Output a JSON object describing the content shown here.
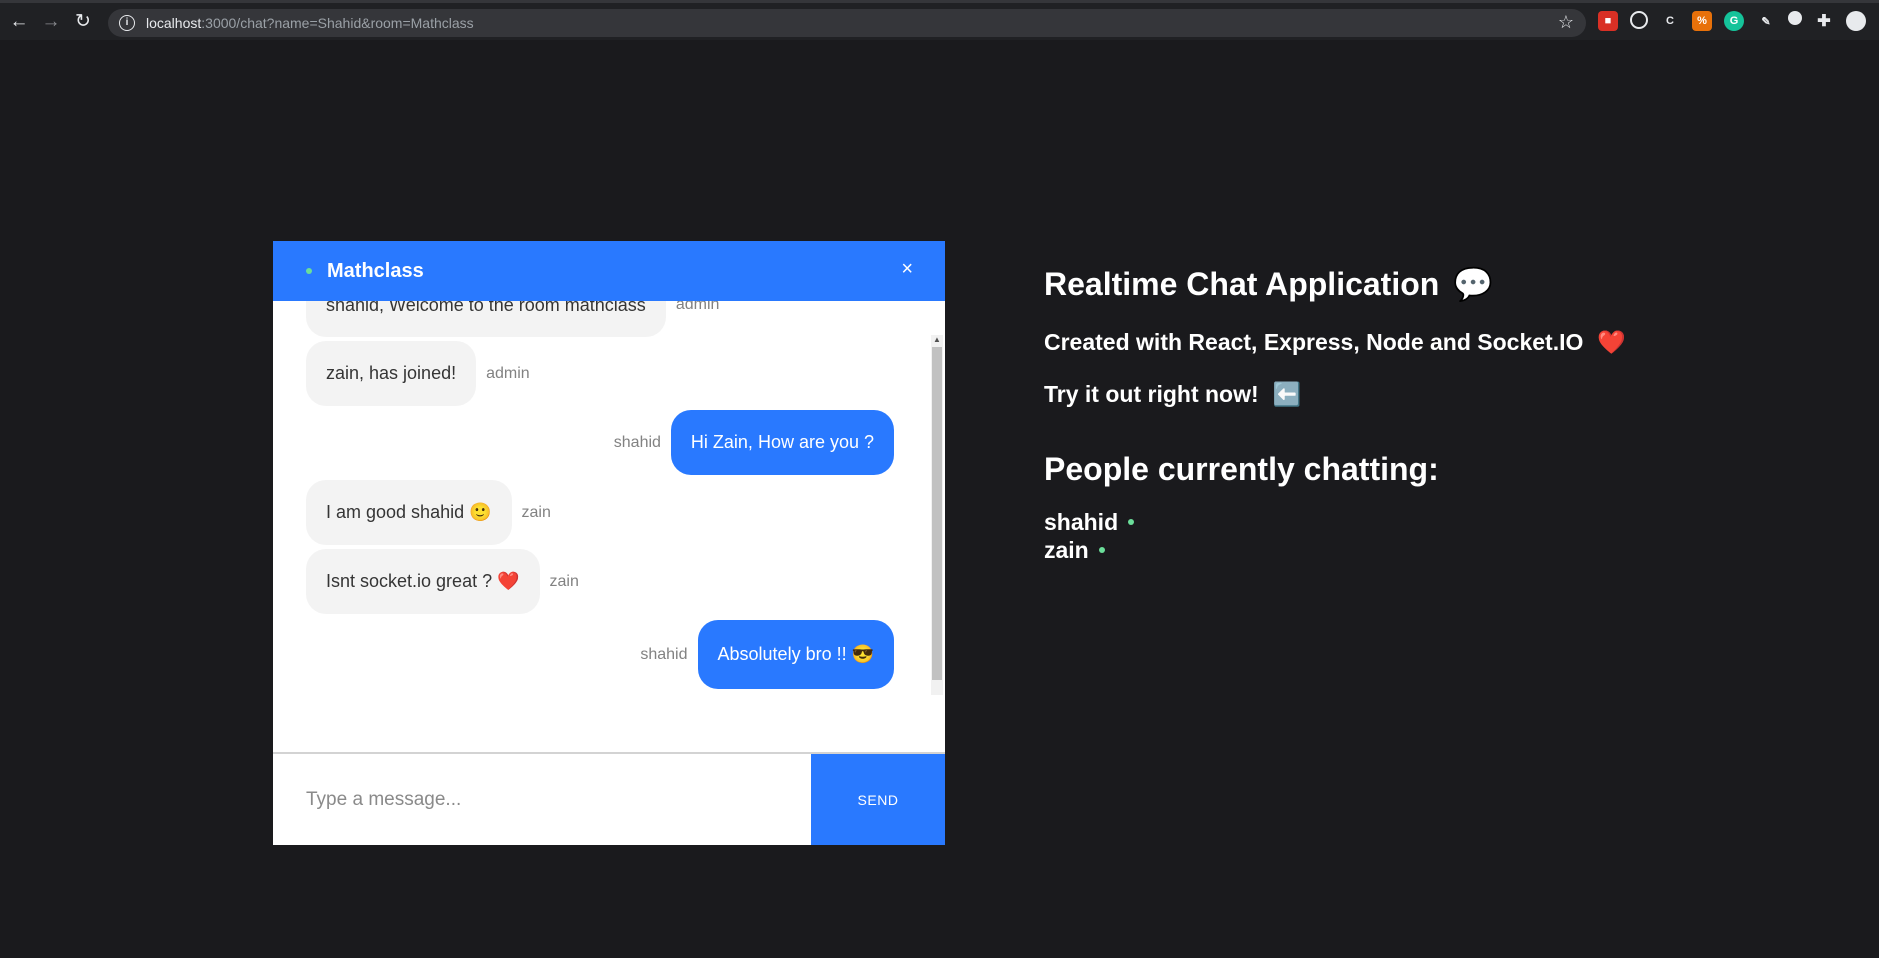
{
  "browser": {
    "url_host": "localhost",
    "url_rest": ":3000/chat?name=Shahid&room=Mathclass"
  },
  "chat": {
    "room": "Mathclass",
    "close_label": "×",
    "messages": [
      {
        "text": "shahid, Welcome to the room mathclass",
        "sender": "admin",
        "side": "left"
      },
      {
        "text": "zain, has joined!",
        "sender": "admin",
        "side": "left"
      },
      {
        "text": "Hi Zain, How are you ?",
        "sender": "shahid",
        "side": "right"
      },
      {
        "text": "I am good shahid 🙂",
        "sender": "zain",
        "side": "left"
      },
      {
        "text": "Isnt socket.io great ? ❤️",
        "sender": "zain",
        "side": "left"
      },
      {
        "text": "Absolutely bro !! 😎",
        "sender": "shahid",
        "side": "right"
      }
    ],
    "input_placeholder": "Type a message...",
    "send_label": "SEND"
  },
  "info": {
    "title": "Realtime Chat Application",
    "title_emoji": "💬",
    "subtitle": "Created with React, Express, Node and Socket.IO",
    "subtitle_emoji": "❤️",
    "cta": "Try it out right now!",
    "cta_emoji": "⬅️",
    "people_title": "People currently chatting:",
    "users": [
      "shahid",
      "zain"
    ]
  },
  "colors": {
    "accent": "#2979ff",
    "background": "#1a1a1d",
    "online": "#6bde9a"
  }
}
